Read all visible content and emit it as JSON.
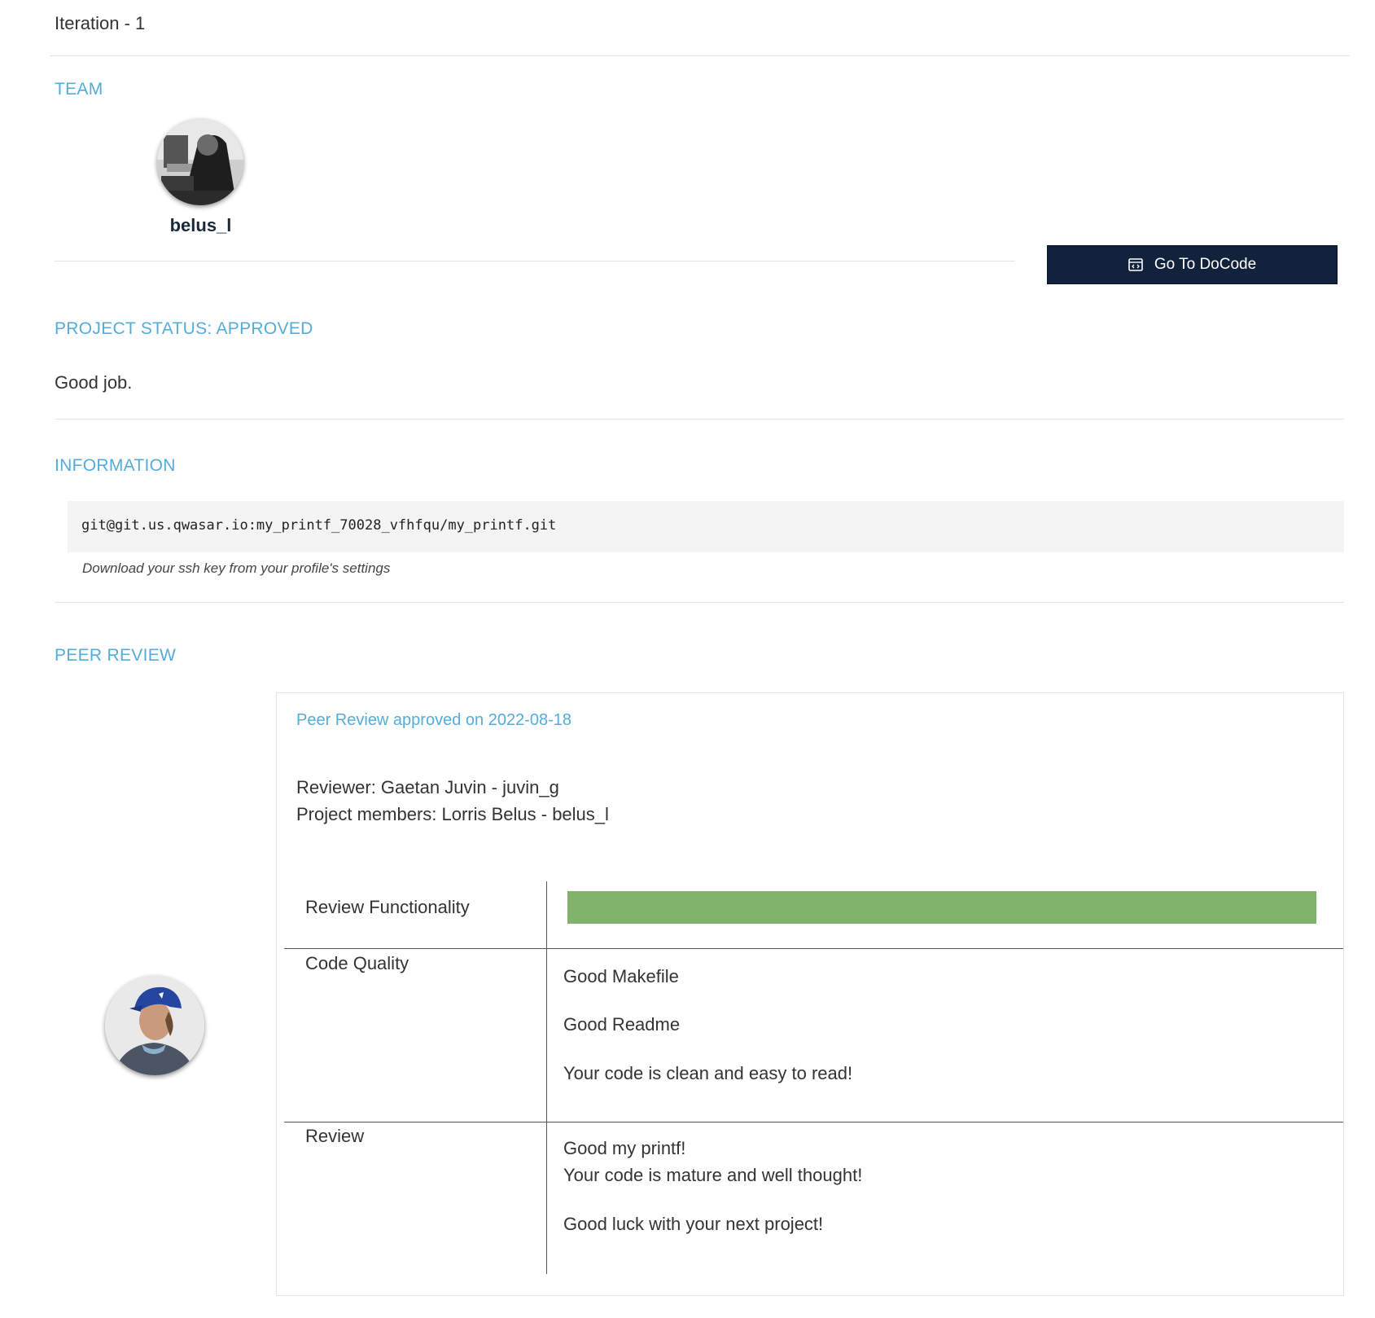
{
  "iteration": {
    "title": "Iteration - 1"
  },
  "team": {
    "heading": "TEAM",
    "members": [
      {
        "username": "belus_l"
      }
    ]
  },
  "docode_button": {
    "label": "Go To DoCode",
    "icon": "code-window-icon"
  },
  "project_status": {
    "heading": "PROJECT STATUS: APPROVED",
    "message": "Good job."
  },
  "information": {
    "heading": "INFORMATION",
    "git_url": "git@git.us.qwasar.io:my_printf_70028_vfhfqu/my_printf.git",
    "hint": "Download your ssh key from your profile's settings"
  },
  "peer_review": {
    "heading": "PEER REVIEW",
    "card_title": "Peer Review approved on 2022-08-18",
    "reviewer_line": "Reviewer: Gaetan Juvin - juvin_g",
    "members_line": "Project members: Lorris Belus - belus_l",
    "rows": [
      {
        "label": "Review Functionality",
        "progress_fraction": 1.0
      },
      {
        "label": "Code Quality",
        "lines": [
          "Good Makefile",
          "Good Readme",
          "Your code is clean and easy to read!"
        ]
      },
      {
        "label": "Review",
        "lines": [
          "Good my printf!",
          "Your code is mature and well thought!",
          "Good luck with your next project!"
        ]
      }
    ]
  },
  "colors": {
    "accent": "#55acd8",
    "button_bg": "#12223d",
    "progress": "#80b26a"
  }
}
